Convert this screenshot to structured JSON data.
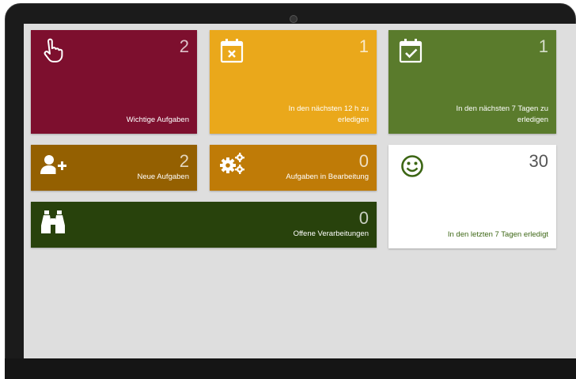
{
  "tiles": [
    {
      "count": "2",
      "label": "Wichtige Aufgaben",
      "icon": "pointing-hand-icon",
      "color": "#7d0f2e"
    },
    {
      "count": "1",
      "label": "In den nächsten 12 h zu erledigen",
      "icon": "calendar-x-icon",
      "color": "#eaa81b"
    },
    {
      "count": "1",
      "label": "In den nächsten 7 Tagen zu erledigen",
      "icon": "calendar-check-icon",
      "color": "#5a7b2c"
    },
    {
      "count": "2",
      "label": "Neue Aufgaben",
      "icon": "add-user-icon",
      "color": "#946001"
    },
    {
      "count": "0",
      "label": "Aufgaben in Bearbeitung",
      "icon": "gears-icon",
      "color": "#bf7b07"
    },
    {
      "count": "30",
      "label": "In den letzten 7 Tagen erledigt",
      "icon": "smiley-icon",
      "color": "#ffffff"
    },
    {
      "count": "0",
      "label": "Offene Verarbeitungen",
      "icon": "binoculars-icon",
      "color": "#28420c"
    }
  ]
}
